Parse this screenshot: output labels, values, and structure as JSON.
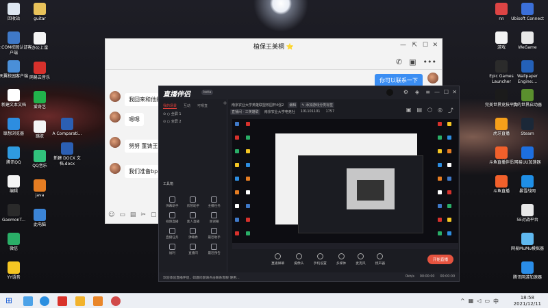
{
  "desktop_left": [
    {
      "label": "回收站",
      "color": "#dde6f0",
      "name": "recycle-bin-icon"
    },
    {
      "label": "Dr.COM校园认证客户端",
      "color": "#3f79c8",
      "name": "drcom-icon"
    },
    {
      "label": "天翼校园客户端",
      "color": "#4a8fd8",
      "name": "tianyi-icon"
    },
    {
      "label": "新建文本文档",
      "color": "#ffffff",
      "name": "text-doc-icon"
    },
    {
      "label": "联想浏览器",
      "color": "#2d8de0",
      "name": "lenovo-browser-icon"
    },
    {
      "label": "腾讯QQ",
      "color": "#2f9be0",
      "name": "qq-icon"
    },
    {
      "label": "编辑",
      "color": "#f4f4f4",
      "name": "edit-doc-icon"
    },
    {
      "label": "GaomonT...",
      "color": "#2a2a2a",
      "name": "gaomon-icon"
    },
    {
      "label": "微信",
      "color": "#2aae67",
      "name": "wechat-icon"
    },
    {
      "label": "YY语音",
      "color": "#f5c623",
      "name": "yy-icon"
    }
  ],
  "desktop_col2": [
    {
      "label": "guitar",
      "color": "#e8c25a",
      "name": "folder-icon"
    },
    {
      "label": "办公上课",
      "color": "#f4f4f4",
      "name": "doc-icon"
    },
    {
      "label": "网易云音乐",
      "color": "#d7312c",
      "name": "netease-music-icon"
    },
    {
      "label": "爱奇艺",
      "color": "#21b24b",
      "name": "iqiyi-icon"
    },
    {
      "label": "跳肤",
      "color": "#f4f4f4",
      "name": "doc-icon"
    },
    {
      "label": "QQ音乐",
      "color": "#31c27c",
      "name": "qqmusic-icon"
    },
    {
      "label": "java",
      "color": "#e67d22",
      "name": "java-icon"
    },
    {
      "label": "此电脑",
      "color": "#3b84d6",
      "name": "this-pc-icon"
    }
  ],
  "desktop_col3": [
    {
      "label": "A Comparati...",
      "color": "#2b5fb3",
      "name": "word-doc-icon"
    },
    {
      "label": "新建 DOCX 文档.docx",
      "color": "#2b5fb3",
      "name": "word-doc-icon"
    }
  ],
  "desktop_right1": [
    {
      "label": "nn",
      "color": "#d44",
      "name": "app-icon"
    },
    {
      "label": "游戏",
      "color": "#f4f4f4",
      "name": "doc-icon"
    },
    {
      "label": "Epic Games Launcher",
      "color": "#2b2b2b",
      "name": "epic-icon"
    },
    {
      "label": "完美世界竞技平台",
      "color": "#1b1b1b",
      "name": "perfect-world-icon"
    },
    {
      "label": "虎牙直播",
      "color": "#f6a01a",
      "name": "huya-icon"
    },
    {
      "label": "斗鱼直播伴侣",
      "color": "#f1602b",
      "name": "douyu-companion-icon"
    },
    {
      "label": "斗鱼直播",
      "color": "#f1602b",
      "name": "douyu-icon"
    }
  ],
  "desktop_right2": [
    {
      "label": "Ubisoft Connect",
      "color": "#3b6fd8",
      "name": "ubisoft-icon"
    },
    {
      "label": "WeGame",
      "color": "#e9e9e9",
      "name": "wegame-icon"
    },
    {
      "label": "Wallpaper Engine:...",
      "color": "#2461b8",
      "name": "wallpaper-engine-icon"
    },
    {
      "label": "我的世界启动器",
      "color": "#5a8f2e",
      "name": "minecraft-icon"
    },
    {
      "label": "Steam",
      "color": "#1b2838",
      "name": "steam-icon"
    },
    {
      "label": "网易UU加速器",
      "color": "#1d6fe0",
      "name": "uu-icon"
    },
    {
      "label": "暴雪战网",
      "color": "#1f8fe6",
      "name": "battlenet-icon"
    },
    {
      "label": "5E对战平台",
      "color": "#e8e8e8",
      "name": "5e-icon"
    },
    {
      "label": "网易MuMu模拟器",
      "color": "#5fb8ef",
      "name": "mumu-icon"
    },
    {
      "label": "腾讯网游加速器",
      "color": "#2a8de8",
      "name": "tencent-accel-icon"
    }
  ],
  "chat": {
    "title": "植保王美桐 ⭐",
    "sent": "你可以联系一下",
    "messages": [
      "我回来和他能",
      "嗯嗯",
      "努努 董铸王",
      "我们准备bp"
    ]
  },
  "live": {
    "logo": "直播伴侣",
    "version": "beta",
    "tabs": [
      "我的场景",
      "互动",
      "可嗯直"
    ],
    "scenes": [
      "⊙ ○ 全屏 1",
      "⊙ ○ 全屏 2"
    ],
    "tools_header": "工具箱",
    "tools": [
      "弹幕助手",
      "房管助手",
      "主播任务",
      "视频直播",
      "素人直播",
      "谢谢幕",
      "直播任务",
      "弹幕秀",
      "最近助手",
      "福利",
      "直播间",
      "最近预告"
    ],
    "info": [
      "南京农业大学英雄联盟校园杯4强2",
      "编辑",
      "直播间 · 三英雄联",
      "南京农业大学电竞社",
      "101101101",
      "1757",
      "✎ 添加游戏分类标签"
    ],
    "bottom_tools": [
      "直播屏幕",
      "摄像头",
      "手机设置",
      "多媒体",
      "麦克风",
      "扬声器"
    ],
    "start": "开始直播",
    "footer_left": "欢迎体验直播伴侣，如遇问题请点击联系客服 使用...",
    "footer_right": [
      "0kb/s",
      "00:00:00",
      "00:00:00"
    ]
  },
  "taskbar": {
    "time": "18:58",
    "date": "2021/12/11",
    "lang": "中"
  }
}
